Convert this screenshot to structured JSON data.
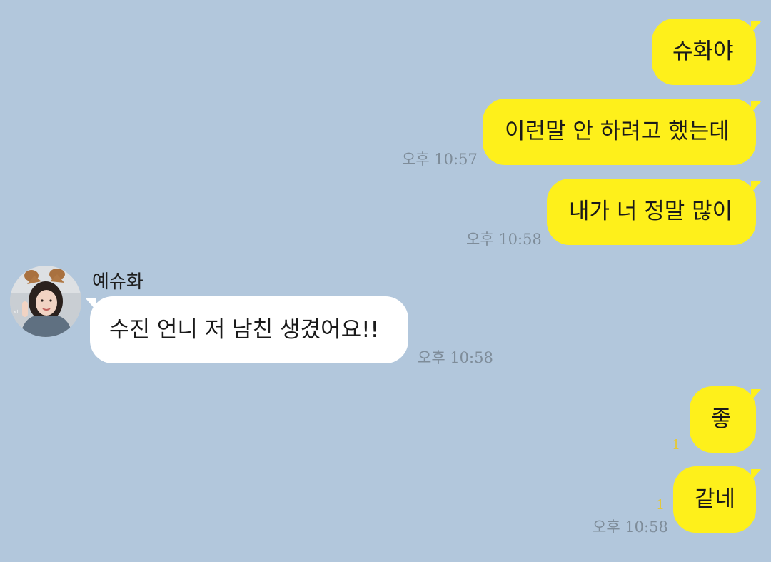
{
  "contact": {
    "name": "예슈화",
    "avatar_icon": "profile-photo"
  },
  "messages": [
    {
      "side": "me",
      "text": "슈화야",
      "time": "",
      "unread": ""
    },
    {
      "side": "me",
      "text": "이런말 안 하려고 했는데",
      "time": "오후 10:57",
      "unread": ""
    },
    {
      "side": "me",
      "text": "내가 너 정말 많이",
      "time": "오후 10:58",
      "unread": ""
    },
    {
      "side": "them",
      "text": "수진 언니 저 남친 생겼어요!!",
      "time": "오후 10:58",
      "unread": ""
    },
    {
      "side": "me",
      "text": "좋",
      "time": "",
      "unread": "1"
    },
    {
      "side": "me",
      "text": "같네",
      "time": "오후 10:58",
      "unread": "1"
    }
  ],
  "colors": {
    "background": "#b2c7dc",
    "my_bubble": "#fef01b",
    "their_bubble": "#ffffff",
    "time_text": "#7e8c99",
    "unread_count": "#e3c83a"
  }
}
